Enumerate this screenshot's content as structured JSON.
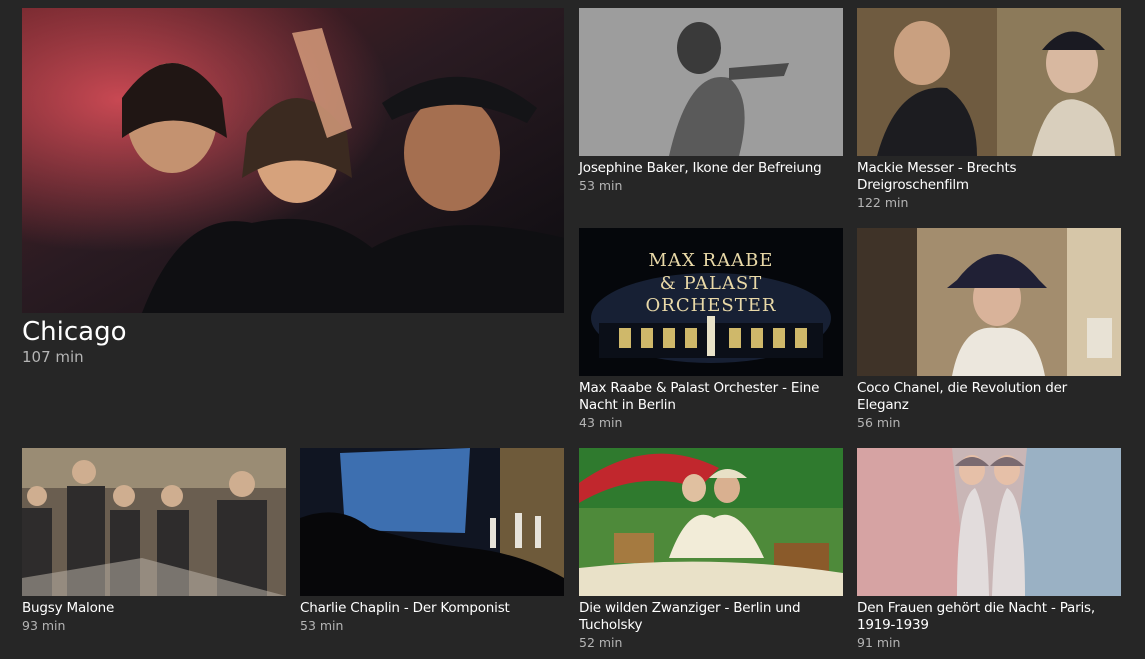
{
  "featured": {
    "title": "Chicago",
    "duration": "107 min",
    "colors": [
      "#3a1c1c",
      "#c7444e",
      "#2a2a3a",
      "#0e0e10"
    ]
  },
  "grid": [
    {
      "title": "Josephine Baker, Ikone der Befreiung",
      "duration": "53 min",
      "colors": [
        "#d2d2d2",
        "#8a8a8a",
        "#5a5a5a",
        "#2c2c2c"
      ]
    },
    {
      "title": "Mackie Messer - Brechts Dreigroschenfilm",
      "duration": "122 min",
      "colors": [
        "#8b6e45",
        "#3a3027",
        "#c9b79b",
        "#1e1a16"
      ]
    },
    {
      "title": "Max Raabe & Palast Orchester - Eine Nacht in Berlin",
      "duration": "43 min",
      "image_text": "MAX RAABE\n& PALAST ORCHESTER",
      "colors": [
        "#05070b",
        "#1a2438",
        "#6b5a2c",
        "#03040a"
      ]
    },
    {
      "title": "Coco Chanel, die Revolution der Eleganz",
      "duration": "56 min",
      "colors": [
        "#bfae8f",
        "#5b4a38",
        "#e8e3d8",
        "#2b2420"
      ]
    },
    {
      "title": "Bugsy Malone",
      "duration": "93 min",
      "colors": [
        "#7a6c58",
        "#3b3a3a",
        "#b5a58a",
        "#1f1d1d"
      ]
    },
    {
      "title": "Charlie Chaplin - Der Komponist",
      "duration": "53 min",
      "colors": [
        "#3d6fb0",
        "#101522",
        "#6e5a3a",
        "#070709"
      ]
    },
    {
      "title": "Die wilden Zwanziger - Berlin und Tucholsky",
      "duration": "52 min",
      "colors": [
        "#c1272d",
        "#2f7a2e",
        "#e9e1c8",
        "#4e8a3a"
      ]
    },
    {
      "title": "Den Frauen gehört die Nacht - Paris, 1919-1939",
      "duration": "91 min",
      "colors": [
        "#d8a0a0",
        "#8fb0c8",
        "#f1d9d9",
        "#b98d8d"
      ]
    }
  ]
}
